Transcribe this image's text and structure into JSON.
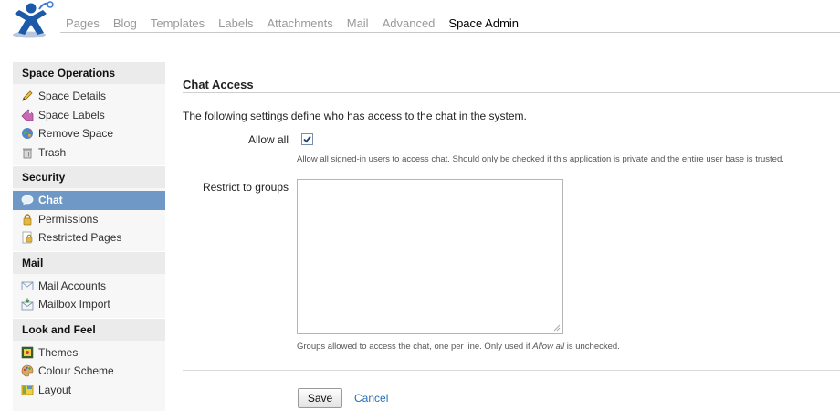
{
  "nav": {
    "items": [
      "Pages",
      "Blog",
      "Templates",
      "Labels",
      "Attachments",
      "Mail",
      "Advanced",
      "Space Admin"
    ],
    "active_index": 7
  },
  "sidebar": {
    "sections": [
      {
        "title": "Space Operations",
        "items": [
          {
            "label": "Space Details",
            "icon": "pencil-icon"
          },
          {
            "label": "Space Labels",
            "icon": "tag-icon"
          },
          {
            "label": "Remove Space",
            "icon": "globe-icon"
          },
          {
            "label": "Trash",
            "icon": "trash-icon"
          }
        ]
      },
      {
        "title": "Security",
        "items": [
          {
            "label": "Chat",
            "icon": "chat-bubble-icon",
            "active": true
          },
          {
            "label": "Permissions",
            "icon": "lock-icon"
          },
          {
            "label": "Restricted Pages",
            "icon": "restricted-page-icon"
          }
        ]
      },
      {
        "title": "Mail",
        "items": [
          {
            "label": "Mail Accounts",
            "icon": "envelope-icon"
          },
          {
            "label": "Mailbox Import",
            "icon": "mailbox-import-icon"
          }
        ]
      },
      {
        "title": "Look and Feel",
        "items": [
          {
            "label": "Themes",
            "icon": "themes-icon"
          },
          {
            "label": "Colour Scheme",
            "icon": "palette-icon"
          },
          {
            "label": "Layout",
            "icon": "layout-icon"
          }
        ]
      }
    ]
  },
  "main": {
    "title": "Chat Access",
    "intro": "The following settings define who has access to the chat in the system.",
    "allow_all": {
      "label": "Allow all",
      "checked": true,
      "hint": "Allow all signed-in users to access chat. Should only be checked if this application is private and the entire user base is trusted."
    },
    "restrict": {
      "label": "Restrict to groups",
      "value": "",
      "hint_before": "Groups allowed to access the chat, one per line. Only used if ",
      "hint_em": "Allow all",
      "hint_after": " is unchecked."
    },
    "save_label": "Save",
    "cancel_label": "Cancel"
  },
  "colors": {
    "active_sidebar": "#6f98c6",
    "link": "#2a6fb5",
    "logo_blue": "#1b5aa8"
  }
}
